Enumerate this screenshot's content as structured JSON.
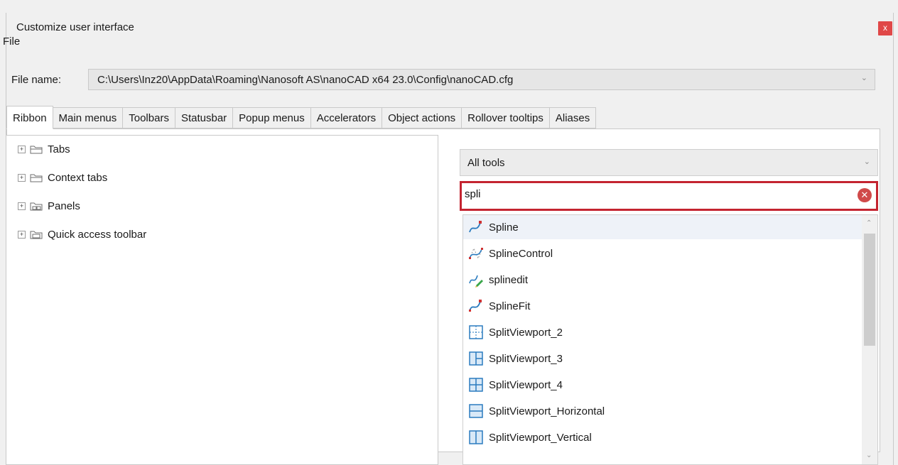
{
  "window": {
    "title": "Customize user interface",
    "close_glyph": "x"
  },
  "menu": {
    "file": "File"
  },
  "file_name": {
    "label": "File name:",
    "value": "C:\\Users\\Inz20\\AppData\\Roaming\\Nanosoft AS\\nanoCAD x64 23.0\\Config\\nanoCAD.cfg"
  },
  "tabs": [
    "Ribbon",
    "Main menus",
    "Toolbars",
    "Statusbar",
    "Popup menus",
    "Accelerators",
    "Object actions",
    "Rollover tooltips",
    "Aliases"
  ],
  "tree": [
    {
      "label": "Tabs",
      "icon": "folder-tabs-icon"
    },
    {
      "label": "Context tabs",
      "icon": "folder-context-tabs-icon"
    },
    {
      "label": "Panels",
      "icon": "folder-panels-icon"
    },
    {
      "label": "Quick access toolbar",
      "icon": "folder-qat-icon"
    }
  ],
  "tools": {
    "filter": "All tools",
    "search": "spli",
    "items": [
      {
        "label": "Spline",
        "icon": "spline-icon"
      },
      {
        "label": "SplineControl",
        "icon": "spline-control-icon"
      },
      {
        "label": "splinedit",
        "icon": "splinedit-icon"
      },
      {
        "label": "SplineFit",
        "icon": "spline-fit-icon"
      },
      {
        "label": "SplitViewport_2",
        "icon": "split-viewport-2-icon"
      },
      {
        "label": "SplitViewport_3",
        "icon": "split-viewport-3-icon"
      },
      {
        "label": "SplitViewport_4",
        "icon": "split-viewport-4-icon"
      },
      {
        "label": "SplitViewport_Horizontal",
        "icon": "split-viewport-horizontal-icon"
      },
      {
        "label": "SplitViewport_Vertical",
        "icon": "split-viewport-vertical-icon"
      }
    ]
  },
  "colors": {
    "accent_border": "#c42430",
    "close_button": "#e04848",
    "icon_blue": "#2a7bbf",
    "icon_red": "#d03030"
  }
}
